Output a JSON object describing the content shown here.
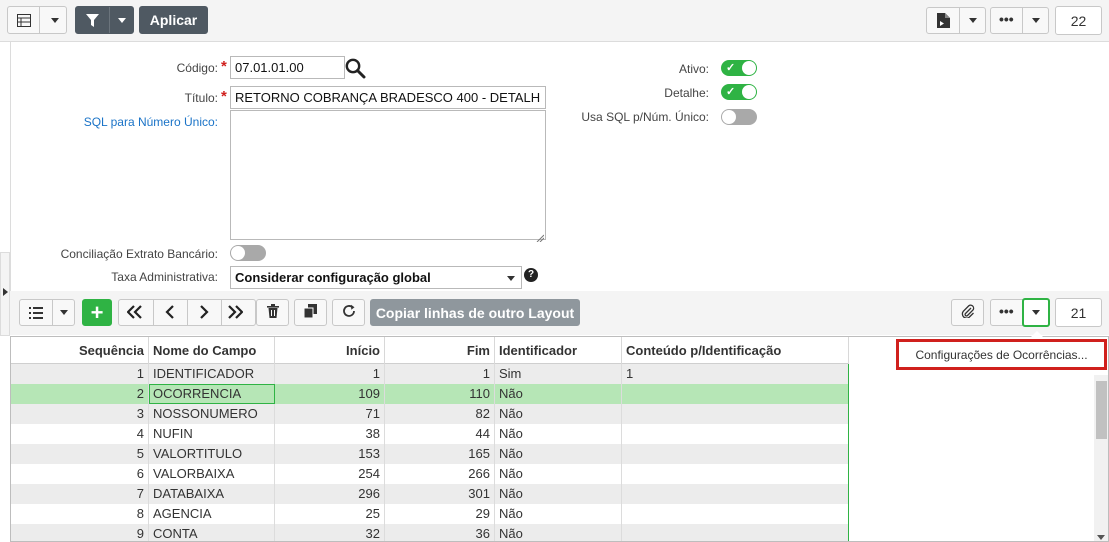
{
  "toolbar": {
    "apply_label": "Aplicar",
    "count": "22"
  },
  "form": {
    "codigo_label": "Código:",
    "codigo_value": "07.01.01.00",
    "titulo_label": "Título:",
    "titulo_value": "RETORNO COBRANÇA BRADESCO 400 - DETALH",
    "sql_label": "SQL para Número Único:",
    "sql_value": "",
    "conciliacao_label": "Conciliação Extrato Bancário:",
    "taxa_label": "Taxa Administrativa:",
    "taxa_value": "Considerar configuração global",
    "ativo_label": "Ativo:",
    "ativo_on": true,
    "detalhe_label": "Detalhe:",
    "detalhe_on": true,
    "usa_sql_label": "Usa SQL p/Núm. Único:",
    "usa_sql_on": false,
    "conciliacao_on": false
  },
  "grid_toolbar": {
    "copy_label": "Copiar linhas de outro Layout",
    "count": "21"
  },
  "grid": {
    "headers": [
      "Sequência",
      "Nome do Campo",
      "Início",
      "Fim",
      "Identificador",
      "Conteúdo p/Identificação"
    ],
    "rows": [
      [
        "1",
        "IDENTIFICADOR",
        "1",
        "1",
        "Sim",
        "1"
      ],
      [
        "2",
        "OCORRENCIA",
        "109",
        "110",
        "Não",
        ""
      ],
      [
        "3",
        "NOSSONUMERO",
        "71",
        "82",
        "Não",
        ""
      ],
      [
        "4",
        "NUFIN",
        "38",
        "44",
        "Não",
        ""
      ],
      [
        "5",
        "VALORTITULO",
        "153",
        "165",
        "Não",
        ""
      ],
      [
        "6",
        "VALORBAIXA",
        "254",
        "266",
        "Não",
        ""
      ],
      [
        "7",
        "DATABAIXA",
        "296",
        "301",
        "Não",
        ""
      ],
      [
        "8",
        "AGENCIA",
        "25",
        "29",
        "Não",
        ""
      ],
      [
        "9",
        "CONTA",
        "32",
        "36",
        "Não",
        ""
      ]
    ],
    "selected_index": 1
  },
  "popup": {
    "label": "Configurações de Ocorrências..."
  },
  "colors": {
    "accent_green": "#2fb344",
    "dark_button": "#4f5962",
    "highlight_red": "#d0201d",
    "selected_row": "#b6e6b6"
  }
}
